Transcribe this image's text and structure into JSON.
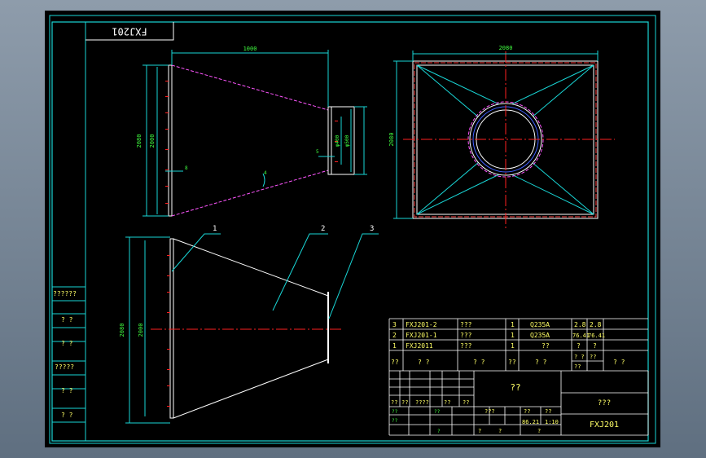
{
  "drawing_number_flipped": "FXJ201",
  "views": {
    "front": {
      "top_dim": "1000",
      "left_outer_dim": "2080",
      "left_inner_dim": "2000",
      "right_dims": [
        "φ400",
        "φ500"
      ],
      "thickness_a": "8",
      "thickness_b": "5",
      "angle": "4"
    },
    "top": {
      "top_dim": "2080",
      "left_dim": "2080"
    },
    "section": {
      "left_outer_dim": "2080",
      "left_inner_dim": "2000",
      "callouts": [
        "1",
        "2",
        "3"
      ]
    }
  },
  "side_stamps": [
    "??????",
    "? ?",
    "? ?",
    "?????",
    "? ?",
    "? ?"
  ],
  "bom": {
    "rows": [
      {
        "no": "3",
        "code": "FXJ201-2",
        "name": "???",
        "qty": "1",
        "material": "Q235A",
        "unit_wt": "2.8",
        "total_wt": "2.8"
      },
      {
        "no": "2",
        "code": "FXJ201-1",
        "name": "???",
        "qty": "1",
        "material": "Q235A",
        "unit_wt": "76.41",
        "total_wt": "76.41"
      },
      {
        "no": "1",
        "code": "FXJ2011",
        "name": "???",
        "qty": "1",
        "material": "??",
        "unit_wt": "?",
        "total_wt": "?"
      }
    ],
    "header": {
      "no": "??",
      "code": "? ?",
      "name": "? ?",
      "qty": "??",
      "material": "? ?",
      "weight_top": "? ?",
      "weight_unit": "??",
      "weight_total": "??",
      "note": "? ?"
    }
  },
  "title_block": {
    "drawing_name": "??",
    "company": "???",
    "drawing_no": "FXJ201",
    "rev_labels": [
      "??",
      "??",
      "????",
      "??",
      "??"
    ],
    "design_labels": [
      "??",
      "??",
      "??",
      "?"
    ],
    "stage_label": "???",
    "weight_label": "??",
    "scale_label": "??",
    "weight_value": "86.21",
    "scale_value": "1:10",
    "sheet_labels": [
      "?",
      "?",
      "?"
    ]
  }
}
